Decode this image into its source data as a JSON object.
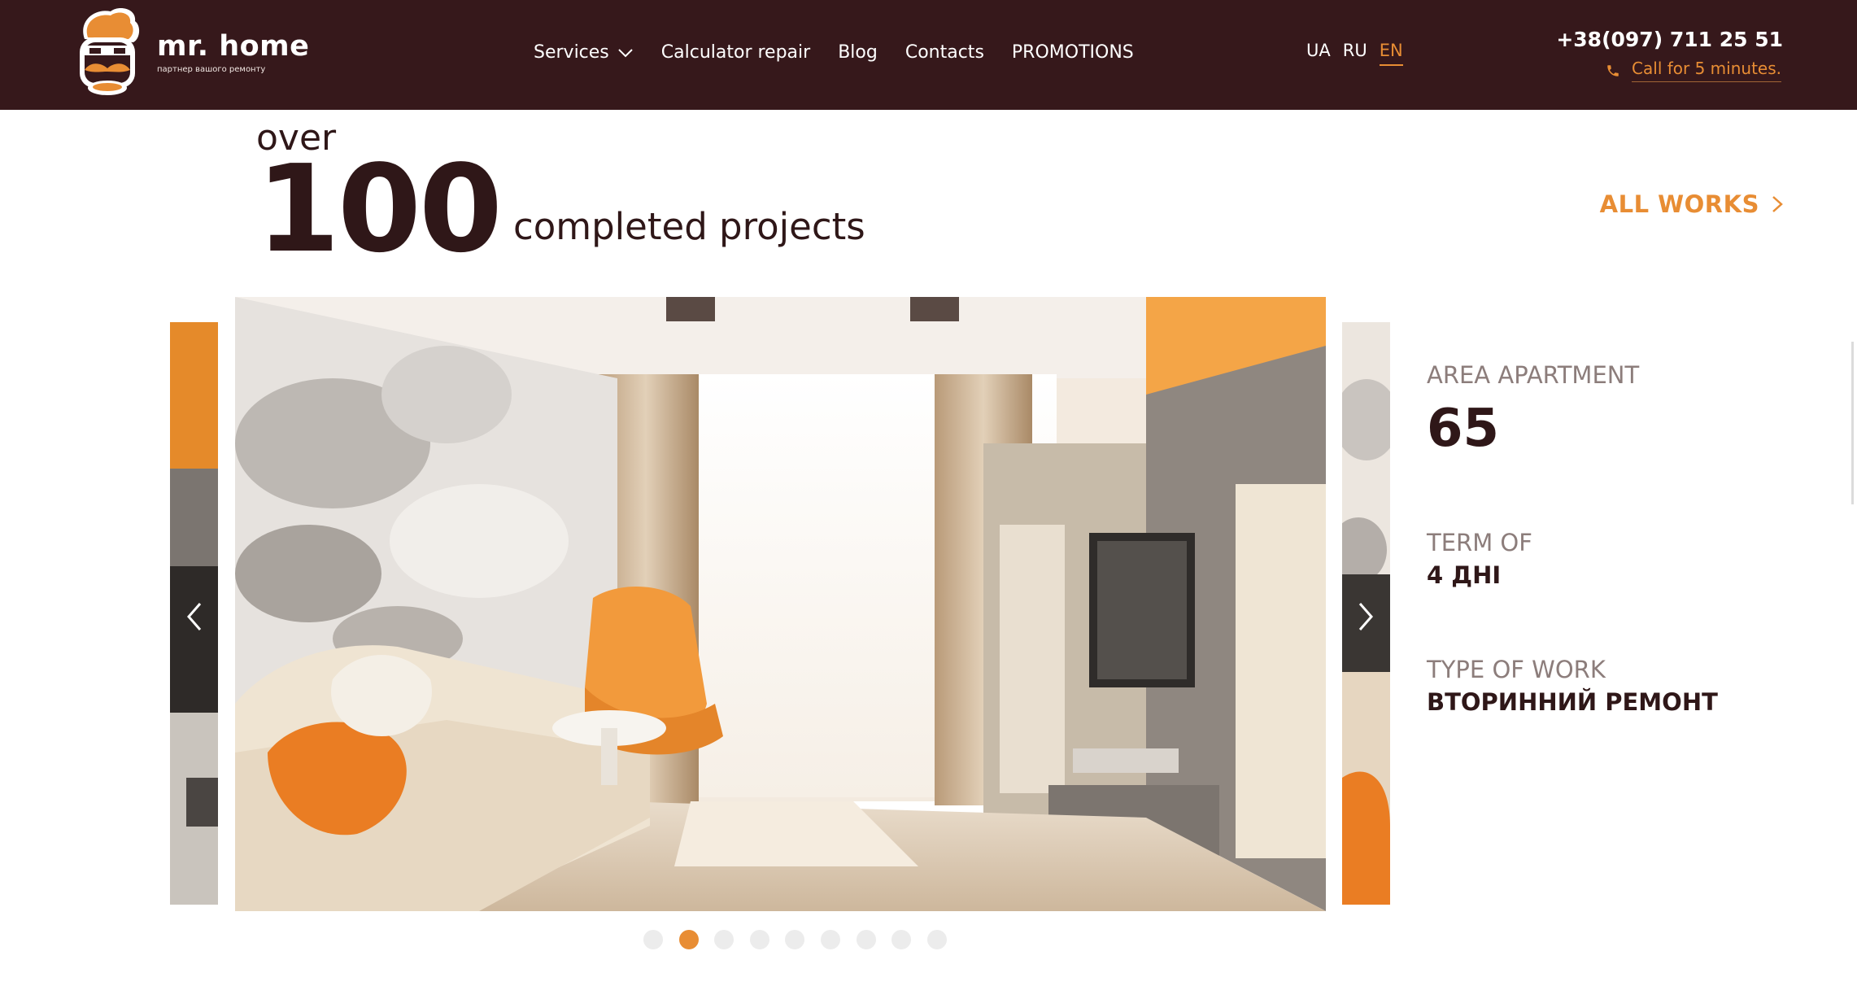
{
  "header": {
    "brand_name": "mr. home",
    "brand_tagline": "партнер вашого ремонту",
    "nav": [
      {
        "label": "Services"
      },
      {
        "label": "Calculator repair"
      },
      {
        "label": "Blog"
      },
      {
        "label": "Contacts"
      },
      {
        "label": "PROMOTIONS"
      }
    ],
    "languages": [
      {
        "label": "UA",
        "active": false
      },
      {
        "label": "RU",
        "active": false
      },
      {
        "label": "EN",
        "active": true
      }
    ],
    "phone": "+38(097) 711 25 51",
    "callback_label": "Call for 5 minutes."
  },
  "hero": {
    "prefix": "over",
    "number": "100",
    "subtitle": "completed projects",
    "all_works_label": "ALL WORKS"
  },
  "project": {
    "area_label": "AREA APARTMENT",
    "area_value": "65",
    "term_label": "TERM OF",
    "term_value": "4 ДНІ",
    "type_label": "TYPE OF WORK",
    "type_value": "ВТОРИННИЙ РЕМОНТ"
  },
  "slider": {
    "dot_count": 9,
    "active_index": 1
  },
  "colors": {
    "header_bg": "#36181b",
    "accent": "#e88d34",
    "text_dark": "#2f1718",
    "text_muted": "#8c7d7b"
  },
  "icons": [
    "logo-mascot-icon",
    "chevron-down-icon",
    "phone-icon",
    "chevron-right-icon",
    "chevron-left-icon"
  ]
}
